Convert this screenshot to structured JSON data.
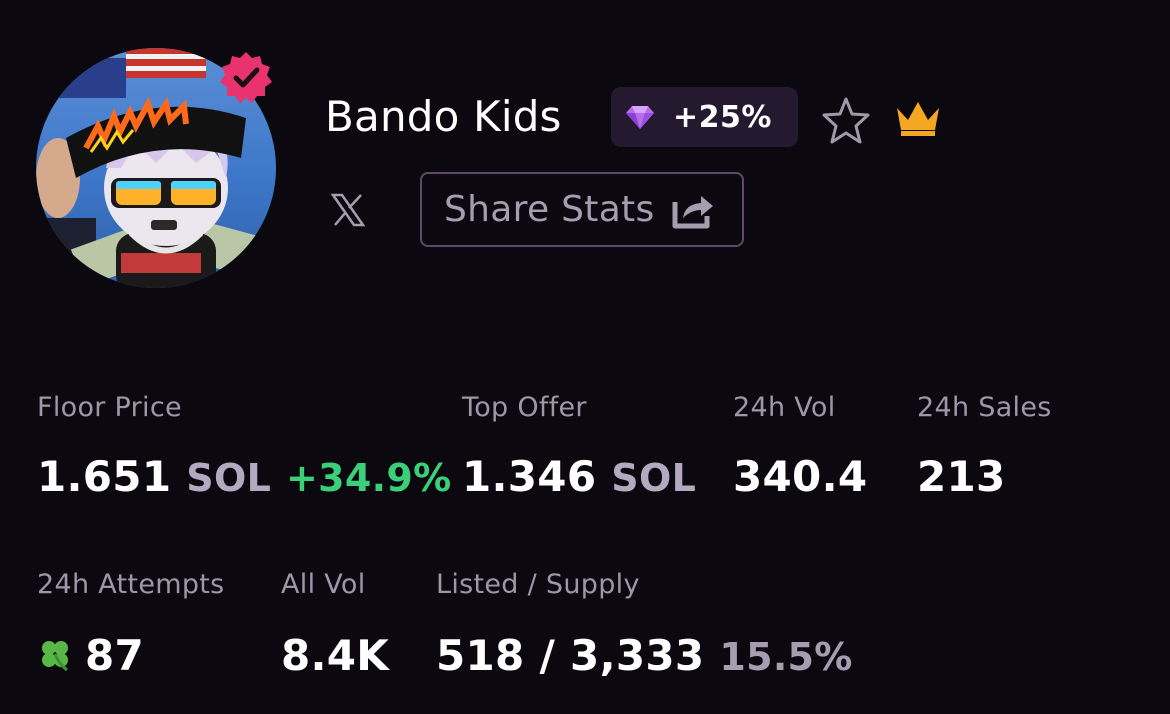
{
  "collection": {
    "name": "Bando Kids",
    "rank_change": "+25%",
    "share_label": "Share Stats"
  },
  "stats_row1": {
    "floor_price": {
      "label": "Floor Price",
      "value": "1.651",
      "unit": "SOL",
      "change": "+34.9%"
    },
    "top_offer": {
      "label": "Top Offer",
      "value": "1.346",
      "unit": "SOL"
    },
    "vol_24h": {
      "label": "24h Vol",
      "value": "340.4"
    },
    "sales_24h": {
      "label": "24h Sales",
      "value": "213"
    }
  },
  "stats_row2": {
    "attempts_24h": {
      "label": "24h Attempts",
      "value": "87"
    },
    "all_vol": {
      "label": "All Vol",
      "value": "8.4K"
    },
    "listed_supply": {
      "label": "Listed / Supply",
      "value": "518 / 3,333",
      "percent": "15.5%"
    }
  },
  "icons": {
    "verified": "verified-badge-icon",
    "rank": "diamond-gem-icon",
    "favorite": "star-outline-icon",
    "top": "crown-icon",
    "social": "x-logo-icon",
    "share": "share-arrow-icon",
    "attempts": "clover-icon"
  },
  "colors": {
    "background": "#0b080f",
    "positive": "#3ad07a",
    "verified": "#e8336f",
    "crown": "#f5a623",
    "gem": "#b56cf0"
  }
}
